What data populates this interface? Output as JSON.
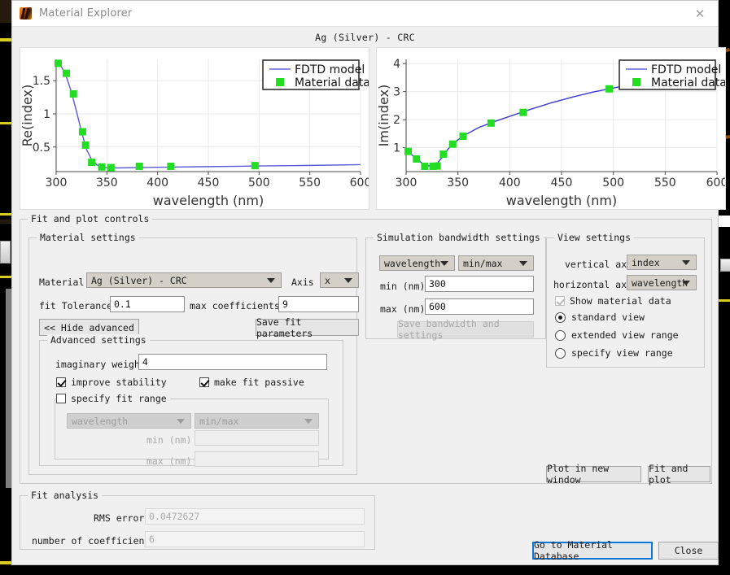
{
  "window": {
    "title": "Material Explorer",
    "app_icon": "lumerical-logo-icon",
    "close_icon": "close-icon"
  },
  "header": {
    "material_title": "Ag (Silver) - CRC"
  },
  "chart_data": [
    {
      "type": "line",
      "id": "re-index-plot",
      "title": "",
      "xlabel": "wavelength (nm)",
      "ylabel": "Re(index)",
      "xlim": [
        300,
        600
      ],
      "ylim": [
        0.13,
        1.82
      ],
      "xticks": [
        300,
        350,
        400,
        450,
        500,
        550,
        600
      ],
      "yticks": [
        0.5,
        1,
        1.5
      ],
      "grid": true,
      "legend_position": "top-right",
      "legend": [
        "FDTD model",
        "Material data"
      ],
      "colors": {
        "model_line": "#5a5ad6",
        "data_marker": "#22dd22"
      },
      "series": [
        {
          "name": "FDTD model",
          "kind": "line",
          "x": [
            300,
            305,
            310,
            315,
            320,
            325,
            330,
            335,
            340,
            345,
            350,
            360,
            380,
            400,
            420,
            450,
            480,
            500,
            530,
            560,
            600
          ],
          "y": [
            1.79,
            1.72,
            1.56,
            1.33,
            1.04,
            0.73,
            0.46,
            0.31,
            0.23,
            0.2,
            0.19,
            0.185,
            0.19,
            0.195,
            0.2,
            0.205,
            0.21,
            0.215,
            0.22,
            0.225,
            0.235
          ]
        },
        {
          "name": "Material data",
          "kind": "scatter",
          "x": [
            302,
            310,
            317,
            326,
            329,
            335,
            345,
            354,
            382,
            413,
            496
          ],
          "y": [
            1.76,
            1.61,
            1.3,
            0.73,
            0.53,
            0.27,
            0.2,
            0.19,
            0.21,
            0.21,
            0.22
          ]
        }
      ]
    },
    {
      "type": "line",
      "id": "im-index-plot",
      "title": "",
      "xlabel": "wavelength (nm)",
      "ylabel": "Im(index)",
      "xlim": [
        300,
        600
      ],
      "ylim": [
        0.15,
        4.15
      ],
      "xticks": [
        300,
        350,
        400,
        450,
        500,
        550,
        600
      ],
      "yticks": [
        1,
        2,
        3,
        4
      ],
      "grid": true,
      "legend_position": "top-right",
      "legend": [
        "FDTD model",
        "Material data"
      ],
      "colors": {
        "model_line": "#3a3ad0",
        "data_marker": "#22dd22"
      },
      "series": [
        {
          "name": "FDTD model",
          "kind": "line",
          "x": [
            300,
            305,
            310,
            315,
            320,
            325,
            330,
            335,
            340,
            345,
            355,
            370,
            385,
            400,
            420,
            440,
            460,
            480,
            500,
            510
          ],
          "y": [
            0.88,
            0.76,
            0.62,
            0.46,
            0.36,
            0.35,
            0.44,
            0.67,
            0.93,
            1.14,
            1.42,
            1.72,
            1.93,
            2.12,
            2.37,
            2.6,
            2.8,
            2.98,
            3.13,
            3.2
          ]
        },
        {
          "name": "Material data",
          "kind": "scatter",
          "x": [
            302,
            310,
            318,
            326,
            330,
            336,
            345,
            355,
            382,
            413,
            496
          ],
          "y": [
            0.87,
            0.6,
            0.34,
            0.34,
            0.35,
            0.77,
            1.13,
            1.41,
            1.88,
            2.26,
            3.1
          ]
        }
      ]
    }
  ],
  "fit_and_plot_controls": {
    "title": "Fit and plot controls",
    "material_settings": {
      "title": "Material settings",
      "material_label": "Material",
      "material_value": "Ag (Silver) - CRC",
      "axis_label": "Axis",
      "axis_value": "x",
      "fit_tolerance_label": "fit Tolerance",
      "fit_tolerance_value": "0.1",
      "max_coefficients_label": "max coefficients",
      "max_coefficients_value": "9",
      "hide_advanced_label": "<< Hide advanced",
      "save_fit_parameters_label": "Save fit parameters"
    },
    "advanced_settings": {
      "title": "Advanced settings",
      "imaginary_weight_label": "imaginary weight",
      "imaginary_weight_value": "4",
      "improve_stability_label": "improve stability",
      "improve_stability_checked": true,
      "make_fit_passive_label": "make fit passive",
      "make_fit_passive_checked": true,
      "specify_fit_range_label": "specify fit range",
      "specify_fit_range_checked": false,
      "range_quantity_value": "wavelength",
      "range_mode_value": "min/max",
      "min_label": "min (nm)",
      "min_value": "",
      "max_label": "max (nm)",
      "max_value": ""
    },
    "simulation_bandwidth_settings": {
      "title": "Simulation bandwidth settings",
      "quantity_value": "wavelength",
      "mode_value": "min/max",
      "min_label": "min (nm)",
      "min_value": "300",
      "max_label": "max (nm)",
      "max_value": "600",
      "save_bandwidth_label": "Save bandwidth and settings"
    },
    "view_settings": {
      "title": "View settings",
      "vertical_axis_label": "vertical axis",
      "vertical_axis_value": "index",
      "horizontal_axis_label": "horizontal axis",
      "horizontal_axis_value": "wavelength",
      "show_material_data_label": "Show material data",
      "show_material_data_checked": true,
      "view_range_options": [
        {
          "label": "standard view",
          "selected": true
        },
        {
          "label": "extended view range",
          "selected": false
        },
        {
          "label": "specify view range",
          "selected": false
        }
      ]
    },
    "plot_in_new_window_label": "Plot in new window",
    "fit_and_plot_label": "Fit and plot"
  },
  "fit_analysis": {
    "title": "Fit analysis",
    "rms_error_label": "RMS error",
    "rms_error_value": "0.0472627",
    "number_of_coefficients_label": "number of coefficients",
    "number_of_coefficients_value": "6"
  },
  "footer": {
    "go_to_material_database_label": "Go to Material Database",
    "close_label": "Close"
  },
  "theme": {
    "accent_focus": "#0a78d4",
    "marker_green": "#22dd22",
    "line_blue": "#4a4ad2",
    "dialog_bg": "#f0f0f0"
  }
}
